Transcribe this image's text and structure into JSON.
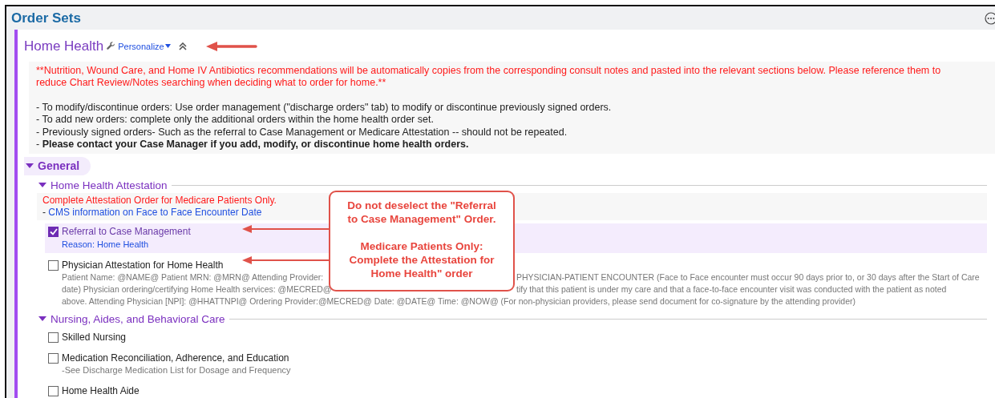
{
  "window": {
    "title": "Order Sets"
  },
  "order_set": {
    "title": "Home Health",
    "personalize": "Personalize"
  },
  "notice": {
    "warning": "**Nutrition, Wound Care, and Home IV Antibiotics recommendations will be automatically copies from the corresponding consult notes and pasted into the relevant sections below. Please reference them to reduce Chart Review/Notes searching when deciding what to order for home.**",
    "lines": [
      "- To modify/discontinue orders: Use order management (\"discharge orders\" tab) to modify or discontinue previously signed orders.",
      "- To add new orders: complete only the additional orders within the home health order set.",
      "- Previously signed orders- Such as the referral to Case Management or Medicare Attestation -- should not be repeated.",
      "- **Please contact your Case Manager if you add, modify, or discontinue home health orders.**"
    ]
  },
  "sections": [
    {
      "title": "General",
      "expanded": true,
      "groups": [
        {
          "title": "Home Health Attestation",
          "expanded": true,
          "note": "Complete Attestation Order for Medicare Patients Only.",
          "link_prefix": "-",
          "link": "CMS information on Face to Face Encounter Date",
          "orders": [
            {
              "label": "Referral to Case Management",
              "checked": true,
              "reason": "Reason: Home Health"
            },
            {
              "label": "Physician Attestation for Home Health",
              "checked": false,
              "detail_lines": [
                {
                  "left": "Patient Name: @NAME@ Patient MRN: @MRN@ Attending Provider:",
                  "right": "PHYSICIAN-PATIENT ENCOUNTER (Face to Face encounter must occur 90 days prior to, or 30 days after the Start of Care"
                },
                {
                  "left": "date) Physician ordering/certifying Home Health services: @MECRED@",
                  "right": "tify that this patient is under my care and that a face-to-face encounter visit was conducted with the patient as noted"
                },
                {
                  "left": "above. Attending Physician [NPI]: @HHATTNPI@ Ordering Provider:@MECRED@ Date: @DATE@ Time: @NOW@ (For non-physician providers, please send document for co-signature by the attending provider)"
                }
              ]
            }
          ]
        },
        {
          "title": "Nursing, Aides, and Behavioral Care",
          "expanded": true,
          "orders": [
            {
              "label": "Skilled Nursing",
              "checked": false
            },
            {
              "label": "Medication Reconciliation, Adherence, and Education",
              "checked": false,
              "description": "-See Discharge Medication List for Dosage and Frequency"
            },
            {
              "label": "Home Health Aide",
              "checked": false
            }
          ]
        }
      ]
    }
  ],
  "callout": {
    "lines": [
      "Do not deselect the \"Referral to Case Management\" Order.",
      "Medicare Patients Only: Complete the Attestation for Home Health\" order"
    ]
  }
}
